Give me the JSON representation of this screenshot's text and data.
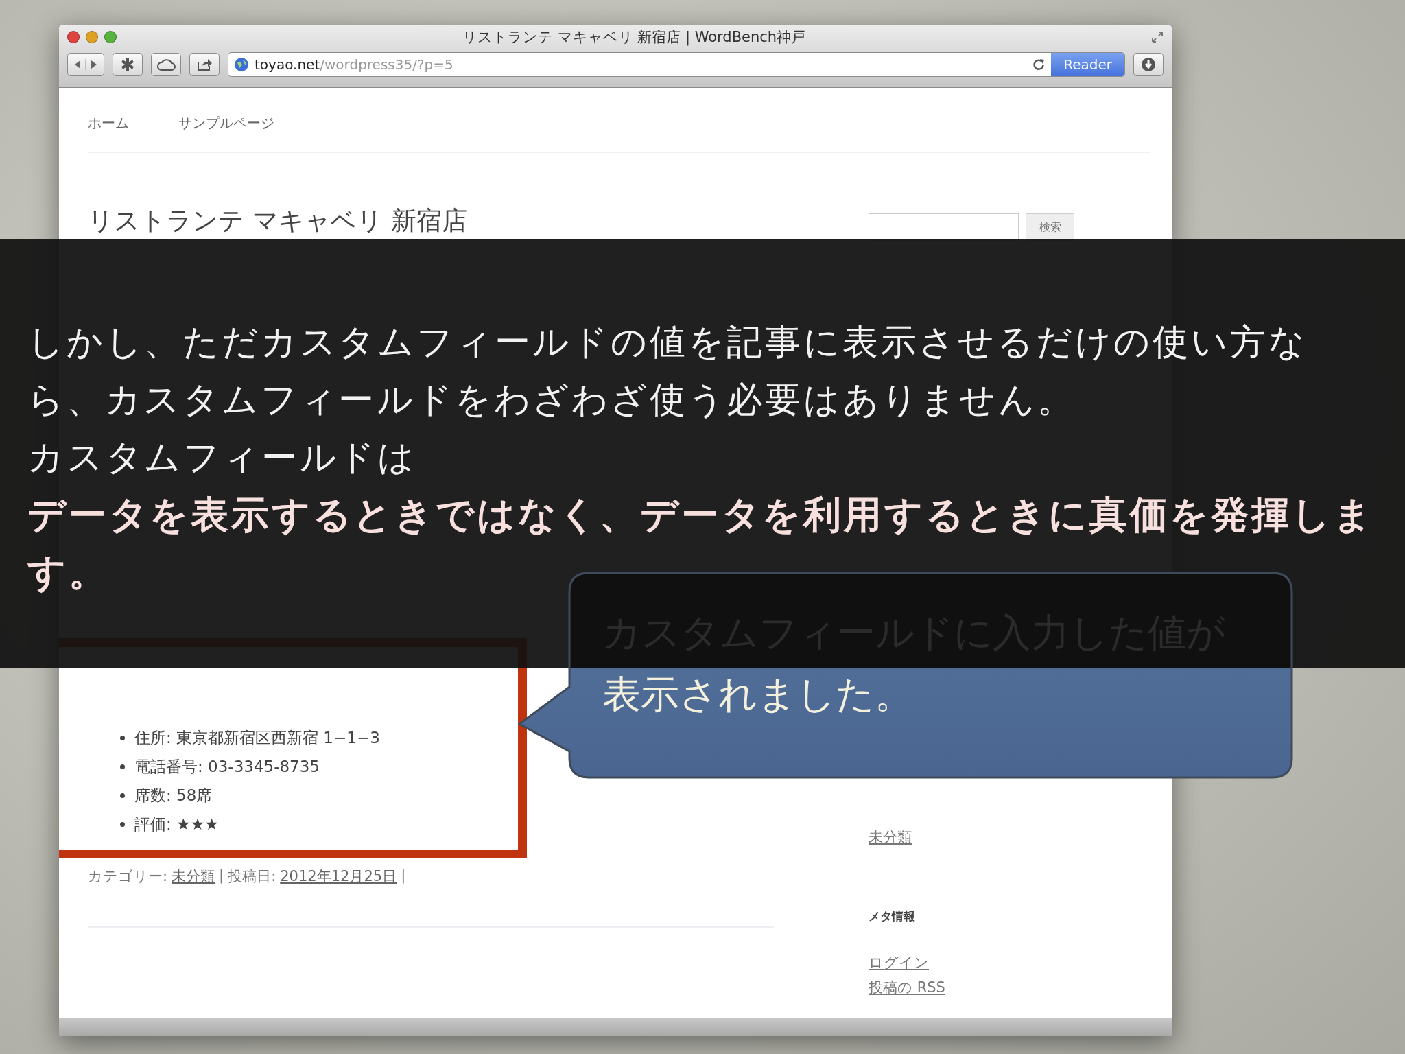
{
  "window": {
    "title": "リストランテ マキャベリ 新宿店 | WordBench神戸"
  },
  "address_bar": {
    "host": "toyao.net",
    "path": "/wordpress35/?p=5"
  },
  "reader_button": {
    "label": "Reader"
  },
  "nav": [
    {
      "label": "ホーム"
    },
    {
      "label": "サンプルページ"
    }
  ],
  "post": {
    "title": "リストランテ マキャベリ 新宿店",
    "fields": [
      {
        "label": "住所:",
        "value": "東京都新宿区西新宿 1−1−3"
      },
      {
        "label": "電話番号:",
        "value": "03-3345-8735"
      },
      {
        "label": "席数:",
        "value": "58席"
      },
      {
        "label": "評価:",
        "value": "★★★"
      }
    ],
    "meta": {
      "category_label": "カテゴリー:",
      "category": "未分類",
      "separator": "|",
      "date_label": "投稿日:",
      "date": "2012年12月25日",
      "end": "|"
    }
  },
  "search": {
    "button": "検索"
  },
  "sidebar": {
    "category_link": "未分類",
    "meta_heading": "メタ情報",
    "meta_links": [
      "ログイン",
      "投稿の RSS"
    ]
  },
  "overlay": {
    "paragraphs": [
      {
        "text": "しかし、ただカスタムフィールドの値を記事に表示させるだけの使い方なら、カスタムフィールドをわざわざ使う必要はありません。",
        "emphasis": false
      },
      {
        "text": "カスタムフィールドは",
        "emphasis": false
      },
      {
        "text": "データを表示するときではなく、データを利用するときに真価を発揮します。",
        "emphasis": true
      }
    ]
  },
  "callout": {
    "lines": [
      "カスタムフィールドに入力した値が",
      "表示されました。"
    ]
  }
}
